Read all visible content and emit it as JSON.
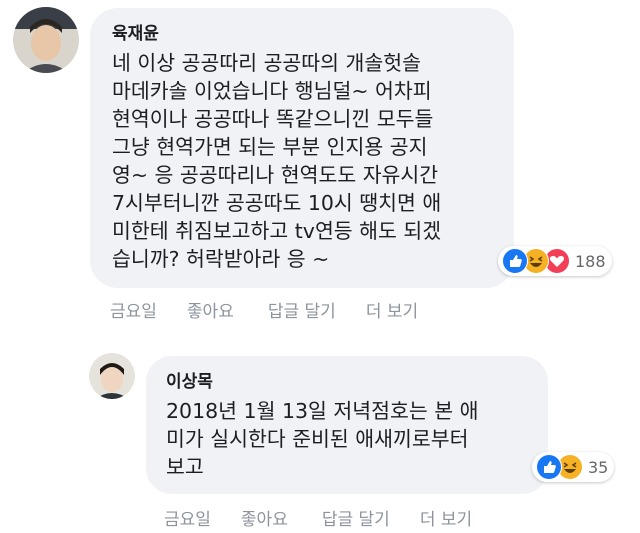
{
  "comments": [
    {
      "author": "육재윤",
      "text": "네 이상 공공따리 공공따의 개솔헛솔\n마데카솔 이었습니다 행님덜~ 어차피\n현역이나 공공따나 똑같으니낀 모두들\n그냥 현역가면 되는 부분 인지용 공지\n영~ 응 공공따리나 현역도도 자유시간\n7시부터니깐 공공따도 10시 땡치면 애\n미한테 취짐보고하고 tv연등 해도 되겠\n습니까? 허락받아라 응 ~",
      "reaction_count": "188",
      "reactions": [
        "like-icon",
        "haha-icon",
        "love-icon"
      ],
      "actions": {
        "time": "금요일",
        "like": "좋아요",
        "reply": "답글 달기",
        "more": "더 보기"
      }
    },
    {
      "author": "이상목",
      "text": "2018년 1월 13일 저녁점호는 본 애\n미가 실시한다 준비된 애새끼로부터\n보고",
      "reaction_count": "35",
      "reactions": [
        "like-icon",
        "haha-icon"
      ],
      "actions": {
        "time": "금요일",
        "like": "좋아요",
        "reply": "답글 달기",
        "more": "더 보기"
      }
    }
  ],
  "colors": {
    "like": "#1877f2",
    "haha": "#f7b125",
    "love": "#f33e58",
    "bubble": "#f0f2f5",
    "meta": "#8d949e"
  }
}
